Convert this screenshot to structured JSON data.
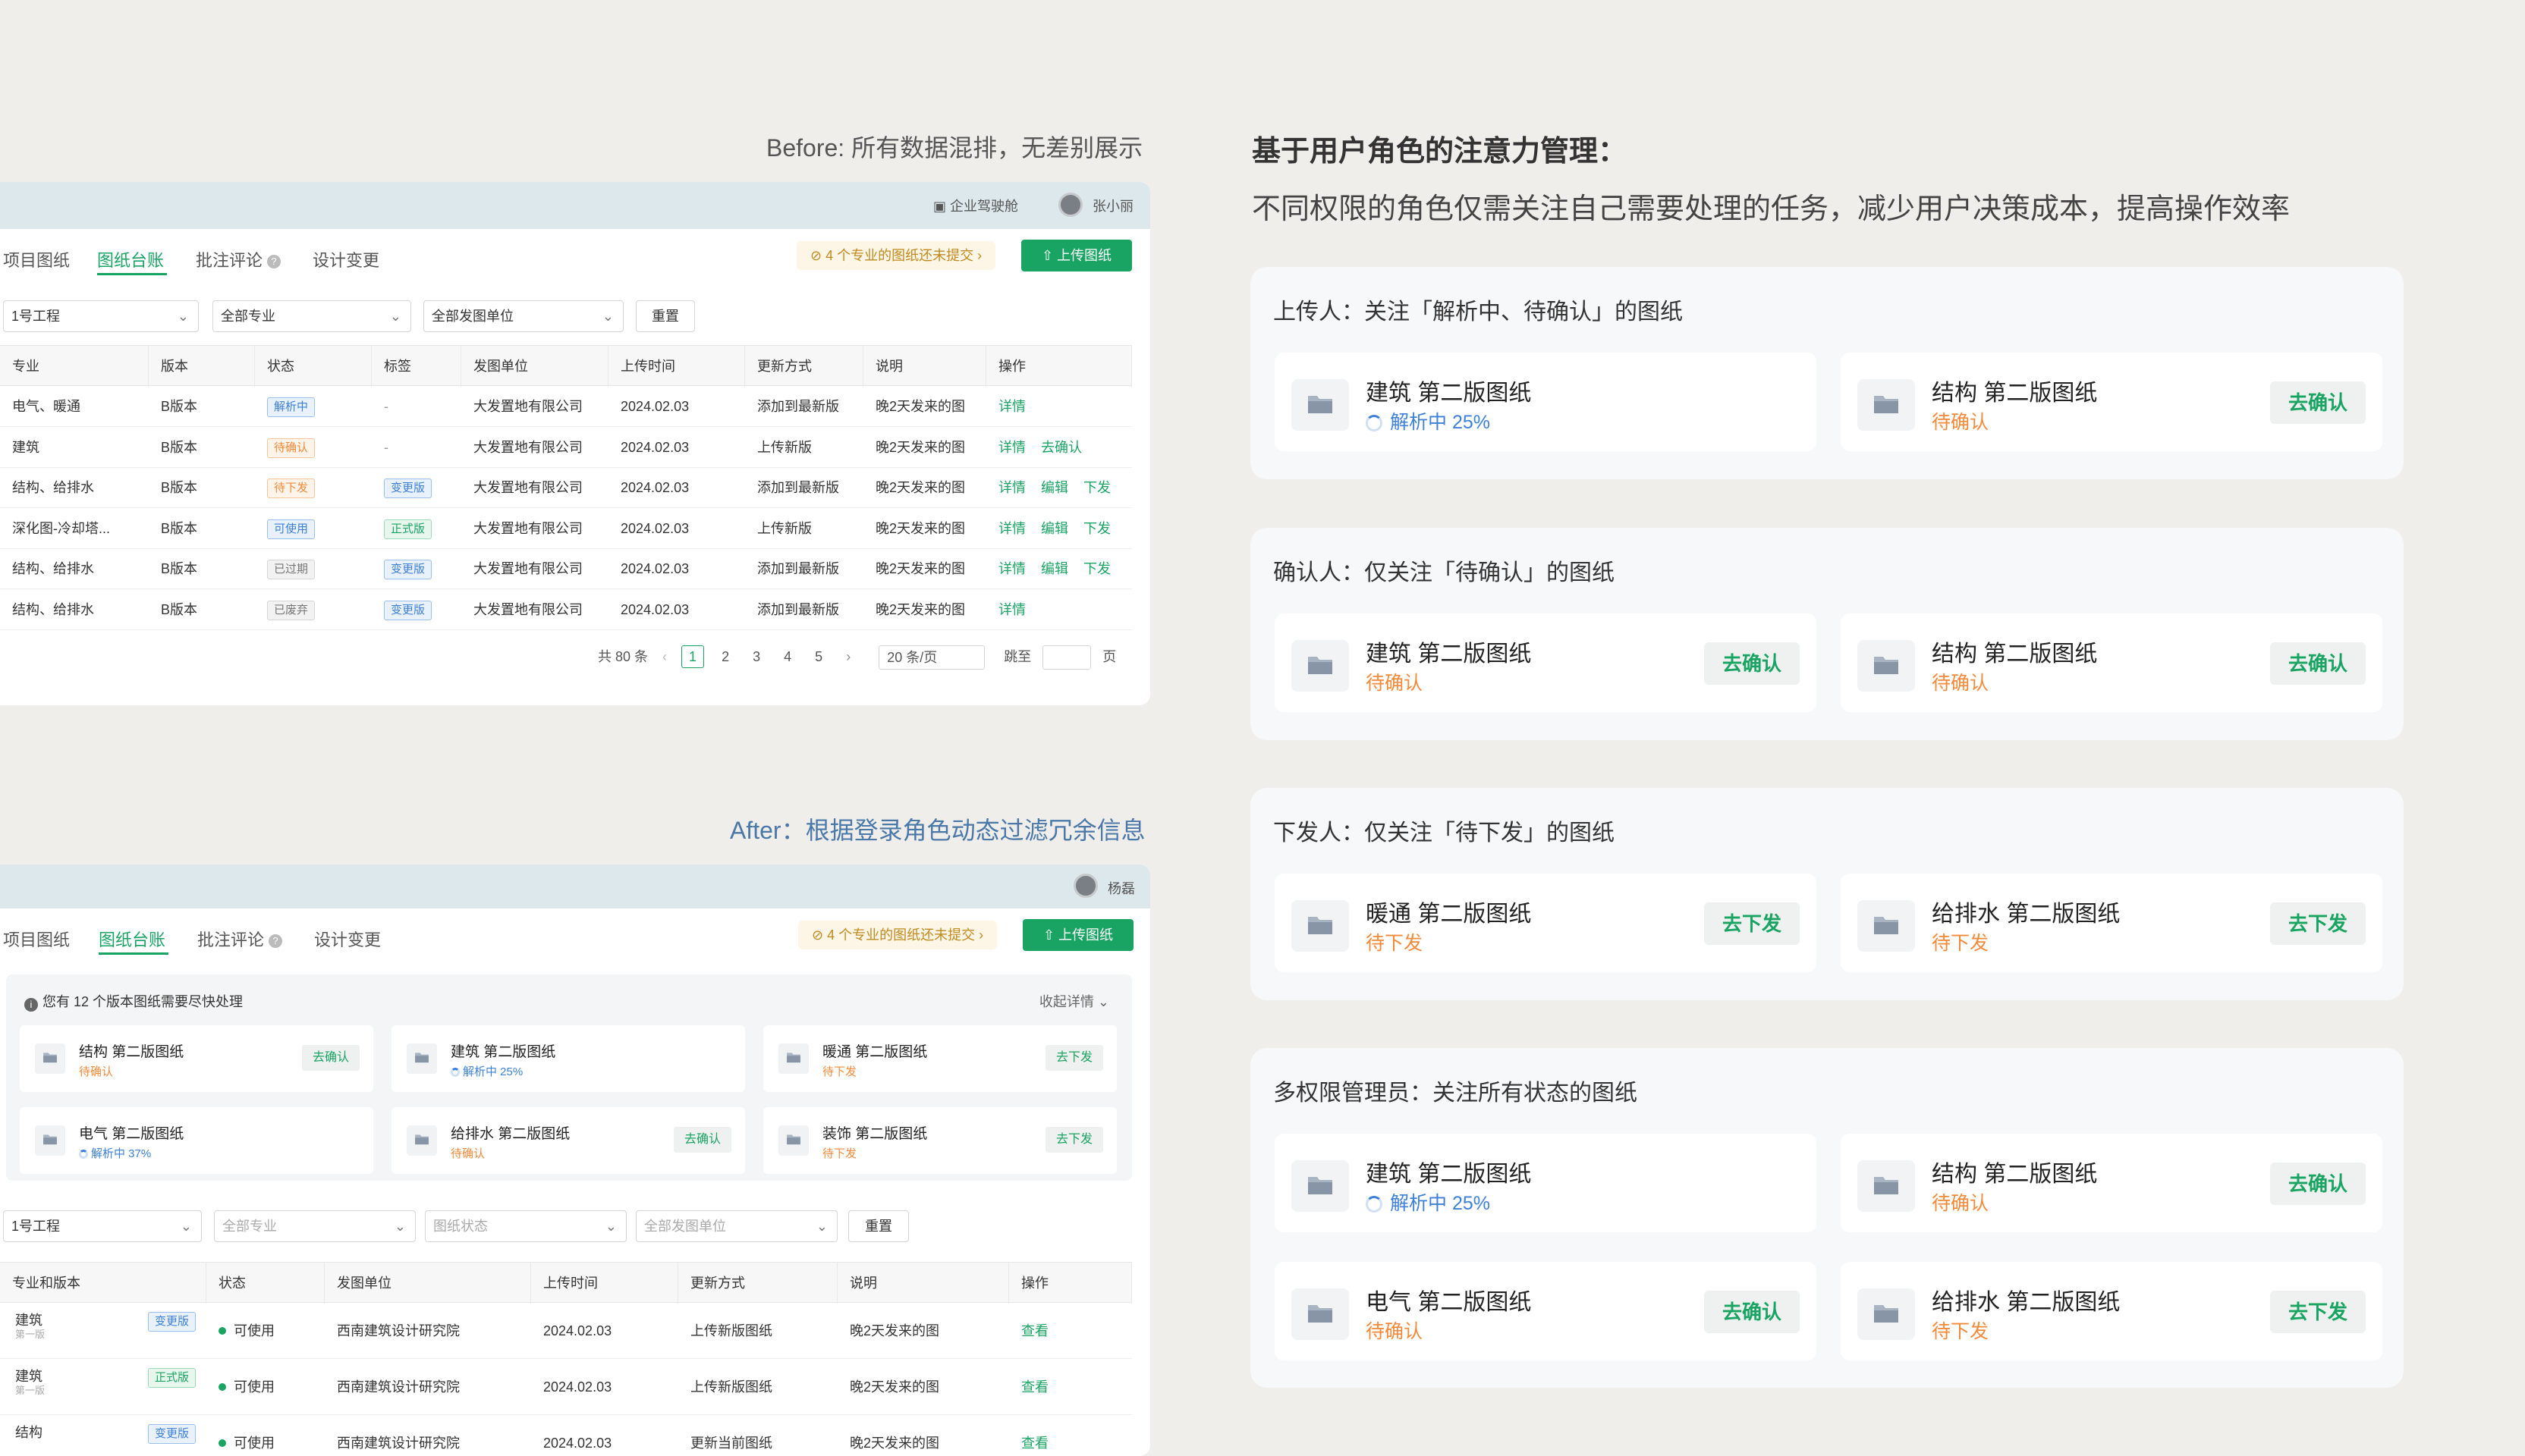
{
  "captions": {
    "before": "Before: 所有数据混排，无差别展示",
    "after": "After：根据登录角色动态过滤冗余信息"
  },
  "before": {
    "topbar": {
      "cockpit": "企业驾驶舱",
      "user": "张小丽"
    },
    "tabs": [
      "项目图纸",
      "图纸台账",
      "批注评论",
      "设计变更"
    ],
    "notice": "4 个专业的图纸还未提交",
    "upload": "上传图纸",
    "filters": [
      "1号工程",
      "全部专业",
      "全部发图单位"
    ],
    "reset": "重置",
    "columns": [
      "专业",
      "版本",
      "状态",
      "标签",
      "发图单位",
      "上传时间",
      "更新方式",
      "说明",
      "操作"
    ],
    "rows": [
      {
        "major": "电气、暖通",
        "ver": "B版本",
        "status": "解析中",
        "tag": "-",
        "unit": "大发置地有限公司",
        "time": "2024.02.03",
        "mode": "添加到最新版",
        "note": "晚2天发来的图",
        "ops": [
          "详情"
        ]
      },
      {
        "major": "建筑",
        "ver": "B版本",
        "status": "待确认",
        "tag": "-",
        "unit": "大发置地有限公司",
        "time": "2024.02.03",
        "mode": "上传新版",
        "note": "晚2天发来的图",
        "ops": [
          "详情",
          "去确认"
        ]
      },
      {
        "major": "结构、给排水",
        "ver": "B版本",
        "status": "待下发",
        "tag": "变更版",
        "unit": "大发置地有限公司",
        "time": "2024.02.03",
        "mode": "添加到最新版",
        "note": "晚2天发来的图",
        "ops": [
          "详情",
          "编辑",
          "下发"
        ]
      },
      {
        "major": "深化图-冷却塔...",
        "ver": "B版本",
        "status": "可使用",
        "tag": "正式版",
        "unit": "大发置地有限公司",
        "time": "2024.02.03",
        "mode": "上传新版",
        "note": "晚2天发来的图",
        "ops": [
          "详情",
          "编辑",
          "下发"
        ]
      },
      {
        "major": "结构、给排水",
        "ver": "B版本",
        "status": "已过期",
        "tag": "变更版",
        "unit": "大发置地有限公司",
        "time": "2024.02.03",
        "mode": "添加到最新版",
        "note": "晚2天发来的图",
        "ops": [
          "详情",
          "编辑",
          "下发"
        ]
      },
      {
        "major": "结构、给排水",
        "ver": "B版本",
        "status": "已废弃",
        "tag": "变更版",
        "unit": "大发置地有限公司",
        "time": "2024.02.03",
        "mode": "添加到最新版",
        "note": "晚2天发来的图",
        "ops": [
          "详情"
        ]
      }
    ],
    "pager": {
      "total": "共 80 条",
      "pages": [
        "1",
        "2",
        "3",
        "4",
        "5"
      ],
      "size": "20 条/页",
      "jump": "跳至",
      "page_unit": "页"
    }
  },
  "after": {
    "topbar": {
      "user": "杨磊"
    },
    "tabs": [
      "项目图纸",
      "图纸台账",
      "批注评论",
      "设计变更"
    ],
    "notice": "4 个专业的图纸还未提交",
    "upload": "上传图纸",
    "todo": {
      "title": "您有 12 个版本图纸需要尽快处理",
      "fold": "收起详情",
      "items": [
        {
          "name": "结构 第二版图纸",
          "status": "待确认",
          "kind": "orange",
          "action": "去确认"
        },
        {
          "name": "建筑 第二版图纸",
          "status": "解析中 25%",
          "kind": "blue",
          "action": ""
        },
        {
          "name": "暖通 第二版图纸",
          "status": "待下发",
          "kind": "orange",
          "action": "去下发"
        },
        {
          "name": "电气 第二版图纸",
          "status": "解析中 37%",
          "kind": "blue",
          "action": ""
        },
        {
          "name": "给排水 第二版图纸",
          "status": "待确认",
          "kind": "orange",
          "action": "去确认"
        },
        {
          "name": "装饰 第二版图纸",
          "status": "待下发",
          "kind": "orange",
          "action": "去下发"
        }
      ]
    },
    "filters": [
      "1号工程",
      "全部专业",
      "图纸状态",
      "全部发图单位"
    ],
    "reset": "重置",
    "columns": [
      "专业和版本",
      "状态",
      "发图单位",
      "上传时间",
      "更新方式",
      "说明",
      "操作"
    ],
    "rows": [
      {
        "major": "建筑",
        "sub": "第一版",
        "tag": "变更版",
        "status": "可使用",
        "unit": "西南建筑设计研究院",
        "time": "2024.02.03",
        "mode": "上传新版图纸",
        "note": "晚2天发来的图",
        "op": "查看"
      },
      {
        "major": "建筑",
        "sub": "第一版",
        "tag": "正式版",
        "status": "可使用",
        "unit": "西南建筑设计研究院",
        "time": "2024.02.03",
        "mode": "上传新版图纸",
        "note": "晚2天发来的图",
        "op": "查看"
      },
      {
        "major": "结构",
        "sub": "",
        "tag": "变更版",
        "status": "可使用",
        "unit": "西南建筑设计研究院",
        "time": "2024.02.03",
        "mode": "更新当前图纸",
        "note": "晚2天发来的图",
        "op": "查看"
      }
    ]
  },
  "right": {
    "heading": "基于用户角色的注意力管理：",
    "subheading": "不同权限的角色仅需关注自己需要处理的任务，减少用户决策成本，提高操作效率",
    "panels": [
      {
        "title": "上传人：关注「解析中、待确认」的图纸",
        "cards": [
          {
            "name": "建筑 第二版图纸",
            "status": "解析中 25%",
            "kind": "blue",
            "action": ""
          },
          {
            "name": "结构 第二版图纸",
            "status": "待确认",
            "kind": "orange",
            "action": "去确认"
          }
        ]
      },
      {
        "title": "确认人：仅关注「待确认」的图纸",
        "cards": [
          {
            "name": "建筑 第二版图纸",
            "status": "待确认",
            "kind": "orange",
            "action": "去确认"
          },
          {
            "name": "结构 第二版图纸",
            "status": "待确认",
            "kind": "orange",
            "action": "去确认"
          }
        ]
      },
      {
        "title": "下发人：仅关注「待下发」的图纸",
        "cards": [
          {
            "name": "暖通 第二版图纸",
            "status": "待下发",
            "kind": "orange",
            "action": "去下发"
          },
          {
            "name": "给排水 第二版图纸",
            "status": "待下发",
            "kind": "orange",
            "action": "去下发"
          }
        ]
      },
      {
        "title": "多权限管理员：关注所有状态的图纸",
        "cards": [
          {
            "name": "建筑 第二版图纸",
            "status": "解析中 25%",
            "kind": "blue",
            "action": ""
          },
          {
            "name": "结构 第二版图纸",
            "status": "待确认",
            "kind": "orange",
            "action": "去确认"
          },
          {
            "name": "电气 第二版图纸",
            "status": "待确认",
            "kind": "orange",
            "action": "去确认"
          },
          {
            "name": "给排水 第二版图纸",
            "status": "待下发",
            "kind": "orange",
            "action": "去下发"
          }
        ]
      }
    ]
  },
  "colors": {
    "accent": "#19a463",
    "blue": "#3d80d8",
    "orange": "#f5893a"
  }
}
